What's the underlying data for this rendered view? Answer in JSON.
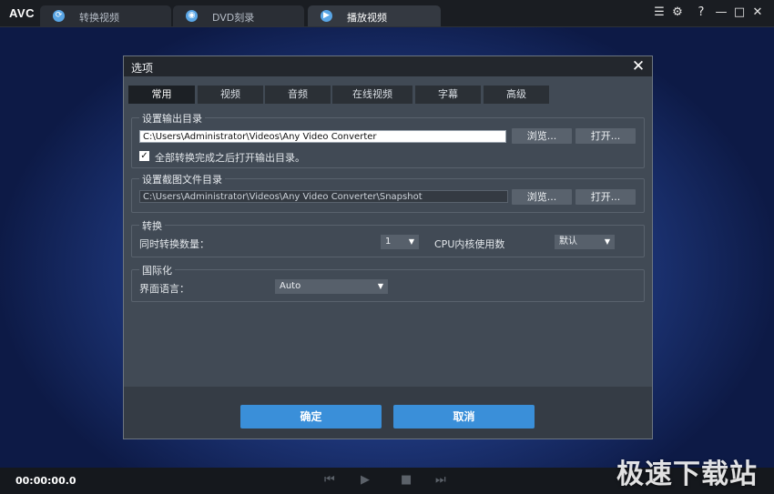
{
  "app": {
    "logo": "AVC",
    "tabs": [
      {
        "label": "转换视频",
        "icon": "convert-icon"
      },
      {
        "label": "DVD刻录",
        "icon": "disc-icon"
      },
      {
        "label": "播放视频",
        "icon": "play-icon"
      }
    ],
    "controls": {
      "menu": "☰",
      "settings": "⚙",
      "help": "?",
      "minimize": "—",
      "maximize": "□",
      "close": "✕"
    }
  },
  "dialog": {
    "title": "选项",
    "tabs": [
      "常用",
      "视频",
      "音频",
      "在线视频",
      "字幕",
      "高级"
    ],
    "output_dir": {
      "title": "设置输出目录",
      "path": "C:\\Users\\Administrator\\Videos\\Any Video Converter",
      "browse": "浏览...",
      "open": "打开...",
      "checkbox_label": "全部转换完成之后打开输出目录。",
      "checked": true
    },
    "snapshot_dir": {
      "title": "设置截图文件目录",
      "path": "C:\\Users\\Administrator\\Videos\\Any Video Converter\\Snapshot",
      "browse": "浏览...",
      "open": "打开..."
    },
    "conversion": {
      "title": "转换",
      "concurrent_label": "同时转换数量：",
      "concurrent_value": "1",
      "cpu_label": "CPU内核使用数",
      "cpu_value": "默认"
    },
    "i18n": {
      "title": "国际化",
      "language_label": "界面语言：",
      "language_value": "Auto"
    },
    "ok": "确定",
    "cancel": "取消"
  },
  "player": {
    "time": "00:00:00.0"
  },
  "watermark": "极速下载站",
  "colors": {
    "accent": "#3a8fd9",
    "dialog_bg": "#414a55",
    "titlebar": "#1a1d22"
  }
}
